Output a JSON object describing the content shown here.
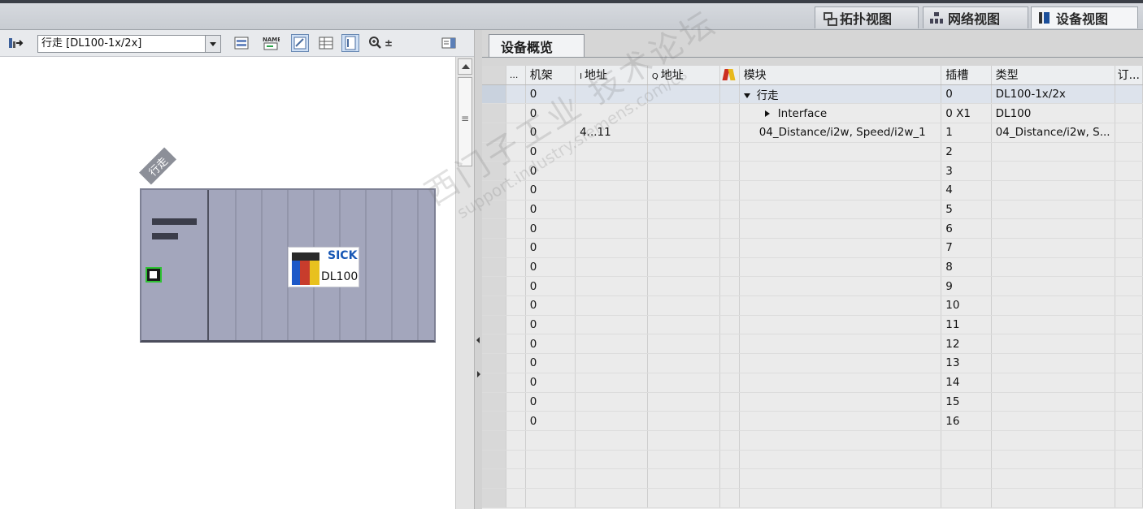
{
  "view_tabs": [
    {
      "label": "拓扑视图",
      "icon": "topology-icon",
      "active": false
    },
    {
      "label": "网络视图",
      "icon": "network-icon",
      "active": false
    },
    {
      "label": "设备视图",
      "icon": "device-view-icon",
      "active": true
    }
  ],
  "left_toolbar": {
    "device_select_value": "行走 [DL100-1x/2x]",
    "zoom_symbol": "±"
  },
  "device": {
    "name_tag": "行走",
    "module_brand": "SICK",
    "module_name": "DL100"
  },
  "overview_tab": "设备概览",
  "grid": {
    "columns": {
      "dots": "...",
      "rack": "机架",
      "i_prefix": "I",
      "i_addr": "地址",
      "q_prefix": "Q",
      "q_addr": "地址",
      "module": "模块",
      "slot": "插槽",
      "type": "类型",
      "order": "订..."
    },
    "rows": [
      {
        "rack": "0",
        "i_addr": "",
        "q_addr": "",
        "module": "行走",
        "slot": "0",
        "type": "DL100-1x/2x"
      },
      {
        "rack": "0",
        "i_addr": "",
        "q_addr": "",
        "module": "Interface",
        "slot": "0 X1",
        "type": "DL100"
      },
      {
        "rack": "0",
        "i_addr": "4...11",
        "q_addr": "",
        "module": "04_Distance/i2w, Speed/i2w_1",
        "slot": "1",
        "type": "04_Distance/i2w, S..."
      },
      {
        "rack": "0",
        "i_addr": "",
        "q_addr": "",
        "module": "",
        "slot": "2",
        "type": ""
      },
      {
        "rack": "0",
        "i_addr": "",
        "q_addr": "",
        "module": "",
        "slot": "3",
        "type": ""
      },
      {
        "rack": "0",
        "i_addr": "",
        "q_addr": "",
        "module": "",
        "slot": "4",
        "type": ""
      },
      {
        "rack": "0",
        "i_addr": "",
        "q_addr": "",
        "module": "",
        "slot": "5",
        "type": ""
      },
      {
        "rack": "0",
        "i_addr": "",
        "q_addr": "",
        "module": "",
        "slot": "6",
        "type": ""
      },
      {
        "rack": "0",
        "i_addr": "",
        "q_addr": "",
        "module": "",
        "slot": "7",
        "type": ""
      },
      {
        "rack": "0",
        "i_addr": "",
        "q_addr": "",
        "module": "",
        "slot": "8",
        "type": ""
      },
      {
        "rack": "0",
        "i_addr": "",
        "q_addr": "",
        "module": "",
        "slot": "9",
        "type": ""
      },
      {
        "rack": "0",
        "i_addr": "",
        "q_addr": "",
        "module": "",
        "slot": "10",
        "type": ""
      },
      {
        "rack": "0",
        "i_addr": "",
        "q_addr": "",
        "module": "",
        "slot": "11",
        "type": ""
      },
      {
        "rack": "0",
        "i_addr": "",
        "q_addr": "",
        "module": "",
        "slot": "12",
        "type": ""
      },
      {
        "rack": "0",
        "i_addr": "",
        "q_addr": "",
        "module": "",
        "slot": "13",
        "type": ""
      },
      {
        "rack": "0",
        "i_addr": "",
        "q_addr": "",
        "module": "",
        "slot": "14",
        "type": ""
      },
      {
        "rack": "0",
        "i_addr": "",
        "q_addr": "",
        "module": "",
        "slot": "15",
        "type": ""
      },
      {
        "rack": "0",
        "i_addr": "",
        "q_addr": "",
        "module": "",
        "slot": "16",
        "type": ""
      }
    ]
  },
  "watermark": {
    "line1": "西门子工业 技术论坛",
    "line2": "support.industry.siemens.com/cs"
  }
}
